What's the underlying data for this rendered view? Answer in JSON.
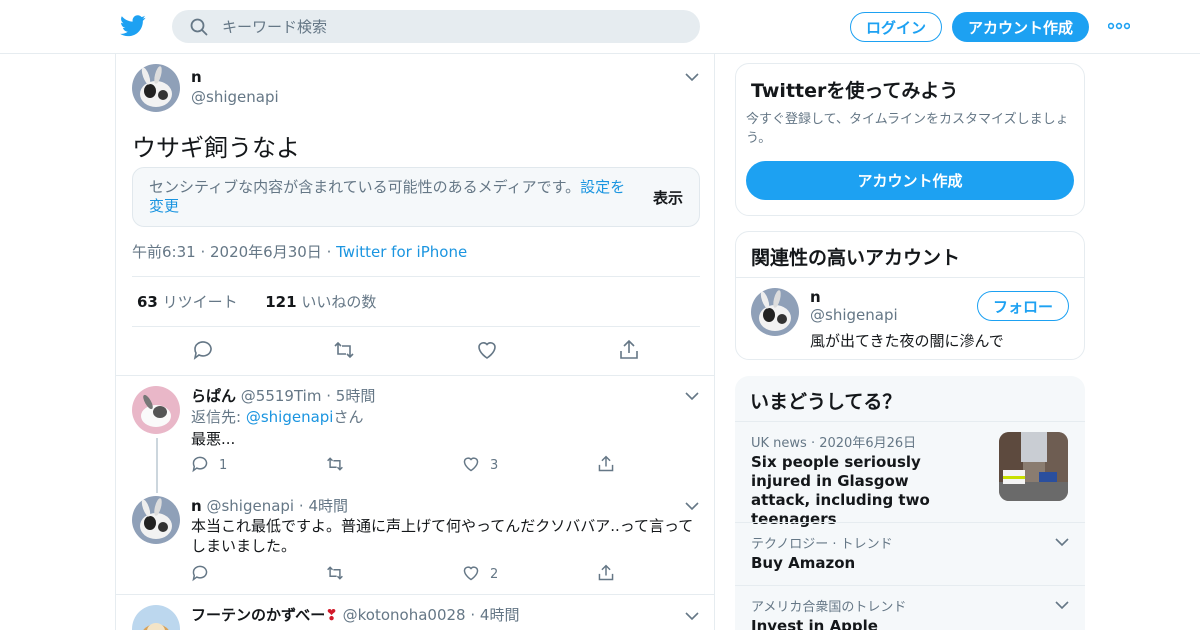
{
  "header": {
    "search_placeholder": "キーワード検索",
    "login_label": "ログイン",
    "signup_label": "アカウント作成"
  },
  "tweet": {
    "name": "n",
    "handle": "@shigenapi",
    "text": "ウサギ飼うなよ",
    "sensitive_msg": "センシティブな内容が含まれている可能性のあるメディアです。",
    "sensitive_link": "設定を変更",
    "show_label": "表示",
    "time": "午前6:31",
    "date": "2020年6月30日",
    "source": "Twitter for iPhone",
    "retweet_count": "63",
    "retweet_label": "リツイート",
    "like_count": "121",
    "like_label": "いいねの数"
  },
  "replies": [
    {
      "name": "らぱん",
      "handle": "@5519Tim",
      "time": "5時間",
      "reply_to_prefix": "返信先: ",
      "reply_to_handle": "@shigenapi",
      "reply_to_suffix": "さん",
      "text": "最悪...",
      "reply_count": "1",
      "retweet_count": "",
      "like_count": "3"
    },
    {
      "name": "n",
      "handle": "@shigenapi",
      "time": "4時間",
      "text": "本当これ最低ですよ。普通に声上げて何やってんだクソババア..って言ってしまいました。",
      "reply_count": "",
      "retweet_count": "",
      "like_count": "2"
    },
    {
      "name": "フーテンのかずべー",
      "emoji": "❣",
      "handle": "@kotonoha0028",
      "time": "4時間"
    }
  ],
  "sidebar": {
    "signup_card": {
      "title": "Twitterを使ってみよう",
      "desc": "今すぐ登録して、タイムラインをカスタマイズしましょう。",
      "button": "アカウント作成"
    },
    "related": {
      "title": "関連性の高いアカウント",
      "name": "n",
      "handle": "@shigenapi",
      "bio": "風が出てきた夜の闇に滲んで",
      "follow": "フォロー"
    },
    "trends": {
      "title": "いまどうしてる？",
      "items": [
        {
          "context_a": "UK news",
          "context_b": "2020年6月26日",
          "title": "Six people seriously injured in Glasgow attack, including two teenagers"
        },
        {
          "context_a": "テクノロジー",
          "context_b": "トレンド",
          "title": "Buy Amazon"
        },
        {
          "context_a": "アメリカ合衆国のトレンド",
          "context_b": "",
          "title": "Invest in Apple"
        }
      ]
    }
  },
  "colors": {
    "brand": "#1da1f2",
    "link": "#1b95e0",
    "muted": "#657786",
    "border": "#e6ecf0"
  }
}
